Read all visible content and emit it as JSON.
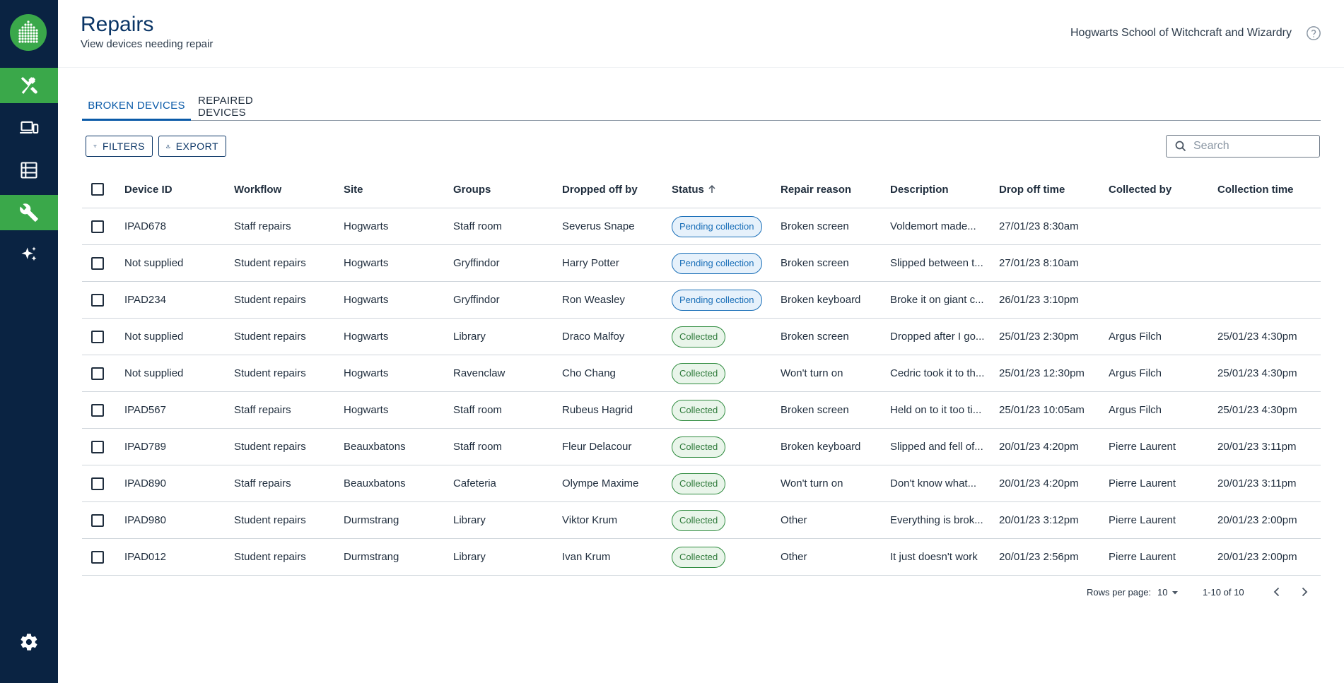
{
  "header": {
    "title": "Repairs",
    "subtitle": "View devices needing repair",
    "school": "Hogwarts School of Witchcraft and Wizardry"
  },
  "sidebar": {
    "items": [
      {
        "icon": "hammer-wrench-icon",
        "active": true
      },
      {
        "icon": "devices-icon",
        "active": false
      },
      {
        "icon": "list-icon",
        "active": false
      },
      {
        "icon": "wrench-icon",
        "active": true
      },
      {
        "icon": "sparkles-icon",
        "active": false
      },
      {
        "icon": "gear-icon",
        "active": false
      }
    ]
  },
  "tabs": {
    "broken": "BROKEN DEVICES",
    "repaired": "REPAIRED DEVICES"
  },
  "toolbar": {
    "filters_label": "FILTERS",
    "export_label": "EXPORT",
    "search_placeholder": "Search"
  },
  "table": {
    "columns": {
      "device_id": "Device ID",
      "workflow": "Workflow",
      "site": "Site",
      "groups": "Groups",
      "dropped_off_by": "Dropped off by",
      "status": "Status",
      "repair_reason": "Repair reason",
      "description": "Description",
      "drop_off_time": "Drop off time",
      "collected_by": "Collected by",
      "collection_time": "Collection time"
    },
    "rows": [
      {
        "device_id": "IPAD678",
        "workflow": "Staff repairs",
        "site": "Hogwarts",
        "groups": "Staff room",
        "dropped_off_by": "Severus Snape",
        "status": "Pending collection",
        "repair_reason": "Broken screen",
        "description": "Voldemort made...",
        "drop_off_time": "27/01/23 8:30am",
        "collected_by": "",
        "collection_time": ""
      },
      {
        "device_id": "Not supplied",
        "workflow": "Student repairs",
        "site": "Hogwarts",
        "groups": "Gryffindor",
        "dropped_off_by": "Harry Potter",
        "status": "Pending collection",
        "repair_reason": "Broken screen",
        "description": "Slipped between t...",
        "drop_off_time": "27/01/23 8:10am",
        "collected_by": "",
        "collection_time": ""
      },
      {
        "device_id": "IPAD234",
        "workflow": "Student repairs",
        "site": "Hogwarts",
        "groups": "Gryffindor",
        "dropped_off_by": "Ron Weasley",
        "status": "Pending collection",
        "repair_reason": "Broken keyboard",
        "description": "Broke it on giant c...",
        "drop_off_time": "26/01/23 3:10pm",
        "collected_by": "",
        "collection_time": ""
      },
      {
        "device_id": "Not supplied",
        "workflow": "Student repairs",
        "site": "Hogwarts",
        "groups": "Library",
        "dropped_off_by": "Draco Malfoy",
        "status": "Collected",
        "repair_reason": "Broken screen",
        "description": "Dropped after I go...",
        "drop_off_time": "25/01/23 2:30pm",
        "collected_by": "Argus Filch",
        "collection_time": "25/01/23 4:30pm"
      },
      {
        "device_id": "Not supplied",
        "workflow": "Student repairs",
        "site": "Hogwarts",
        "groups": "Ravenclaw",
        "dropped_off_by": "Cho Chang",
        "status": "Collected",
        "repair_reason": "Won't turn on",
        "description": "Cedric took it to th...",
        "drop_off_time": "25/01/23 12:30pm",
        "collected_by": "Argus Filch",
        "collection_time": "25/01/23 4:30pm"
      },
      {
        "device_id": "IPAD567",
        "workflow": "Staff repairs",
        "site": "Hogwarts",
        "groups": "Staff room",
        "dropped_off_by": "Rubeus Hagrid",
        "status": "Collected",
        "repair_reason": "Broken screen",
        "description": "Held on to it too ti...",
        "drop_off_time": "25/01/23 10:05am",
        "collected_by": "Argus Filch",
        "collection_time": "25/01/23 4:30pm"
      },
      {
        "device_id": "IPAD789",
        "workflow": "Student repairs",
        "site": "Beauxbatons",
        "groups": "Staff room",
        "dropped_off_by": "Fleur Delacour",
        "status": "Collected",
        "repair_reason": "Broken keyboard",
        "description": "Slipped and fell of...",
        "drop_off_time": "20/01/23 4:20pm",
        "collected_by": "Pierre Laurent",
        "collection_time": "20/01/23 3:11pm"
      },
      {
        "device_id": "IPAD890",
        "workflow": "Staff repairs",
        "site": "Beauxbatons",
        "groups": "Cafeteria",
        "dropped_off_by": "Olympe Maxime",
        "status": "Collected",
        "repair_reason": "Won't turn on",
        "description": "Don't know what...",
        "drop_off_time": "20/01/23 4:20pm",
        "collected_by": "Pierre Laurent",
        "collection_time": "20/01/23 3:11pm"
      },
      {
        "device_id": "IPAD980",
        "workflow": "Student repairs",
        "site": "Durmstrang",
        "groups": "Library",
        "dropped_off_by": "Viktor Krum",
        "status": "Collected",
        "repair_reason": "Other",
        "description": "Everything is brok...",
        "drop_off_time": "20/01/23 3:12pm",
        "collected_by": "Pierre Laurent",
        "collection_time": "20/01/23 2:00pm"
      },
      {
        "device_id": "IPAD012",
        "workflow": "Student repairs",
        "site": "Durmstrang",
        "groups": "Library",
        "dropped_off_by": "Ivan Krum",
        "status": "Collected",
        "repair_reason": "Other",
        "description": "It just doesn't work",
        "drop_off_time": "20/01/23 2:56pm",
        "collected_by": "Pierre Laurent",
        "collection_time": "20/01/23 2:00pm"
      }
    ]
  },
  "pagination": {
    "rows_per_page_label": "Rows per page:",
    "rows_per_page": "10",
    "range": "1-10 of 10"
  },
  "colors": {
    "sidebar_bg": "#0a2342",
    "accent_green": "#3aa84a",
    "primary_blue": "#0a5aa8",
    "pending": "#1a6fb8",
    "collected": "#2e8b3e"
  }
}
